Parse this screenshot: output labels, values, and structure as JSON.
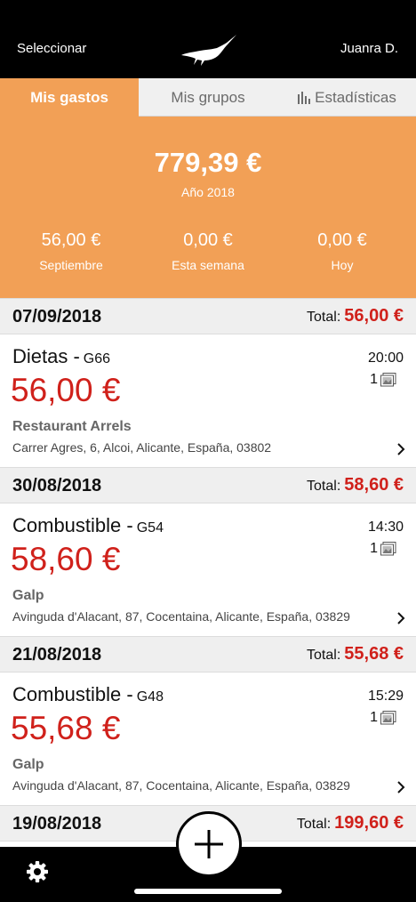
{
  "topbar": {
    "select_label": "Seleccionar",
    "user_label": "Juanra D.",
    "logo_icon": "bird-logo-icon"
  },
  "tabs": [
    {
      "label": "Mis gastos",
      "active": true
    },
    {
      "label": "Mis grupos",
      "active": false
    },
    {
      "label": "Estadísticas",
      "active": false,
      "icon": "bar-chart-icon"
    }
  ],
  "summary": {
    "total": "779,39 €",
    "period": "Año 2018",
    "stats": [
      {
        "value": "56,00 €",
        "label": "Septiembre"
      },
      {
        "value": "0,00 €",
        "label": "Esta semana"
      },
      {
        "value": "0,00 €",
        "label": "Hoy"
      }
    ]
  },
  "days": [
    {
      "date": "07/09/2018",
      "total_label": "Total:",
      "total": "56,00 €",
      "item": {
        "category": "Dietas -",
        "code": "G66",
        "amount": "56,00 €",
        "time": "20:00",
        "attachments": "1",
        "place": "Restaurant Arrels",
        "address": "Carrer Agres, 6, Alcoi, Alicante, España, 03802"
      }
    },
    {
      "date": "30/08/2018",
      "total_label": "Total:",
      "total": "58,60 €",
      "item": {
        "category": "Combustible -",
        "code": "G54",
        "amount": "58,60 €",
        "time": "14:30",
        "attachments": "1",
        "place": "Galp",
        "address": "Avinguda d'Alacant, 87, Cocentaina, Alicante, España, 03829"
      }
    },
    {
      "date": "21/08/2018",
      "total_label": "Total:",
      "total": "55,68 €",
      "item": {
        "category": "Combustible -",
        "code": "G48",
        "amount": "55,68 €",
        "time": "15:29",
        "attachments": "1",
        "place": "Galp",
        "address": "Avinguda d'Alacant, 87, Cocentaina, Alicante, España, 03829"
      }
    },
    {
      "date": "19/08/2018",
      "total_label": "Total:",
      "total": "199,60 €"
    }
  ],
  "colors": {
    "accent": "#f2a056",
    "amount": "#d0211b"
  },
  "bottom": {
    "settings_icon": "gear-icon",
    "add_icon": "plus-icon"
  }
}
